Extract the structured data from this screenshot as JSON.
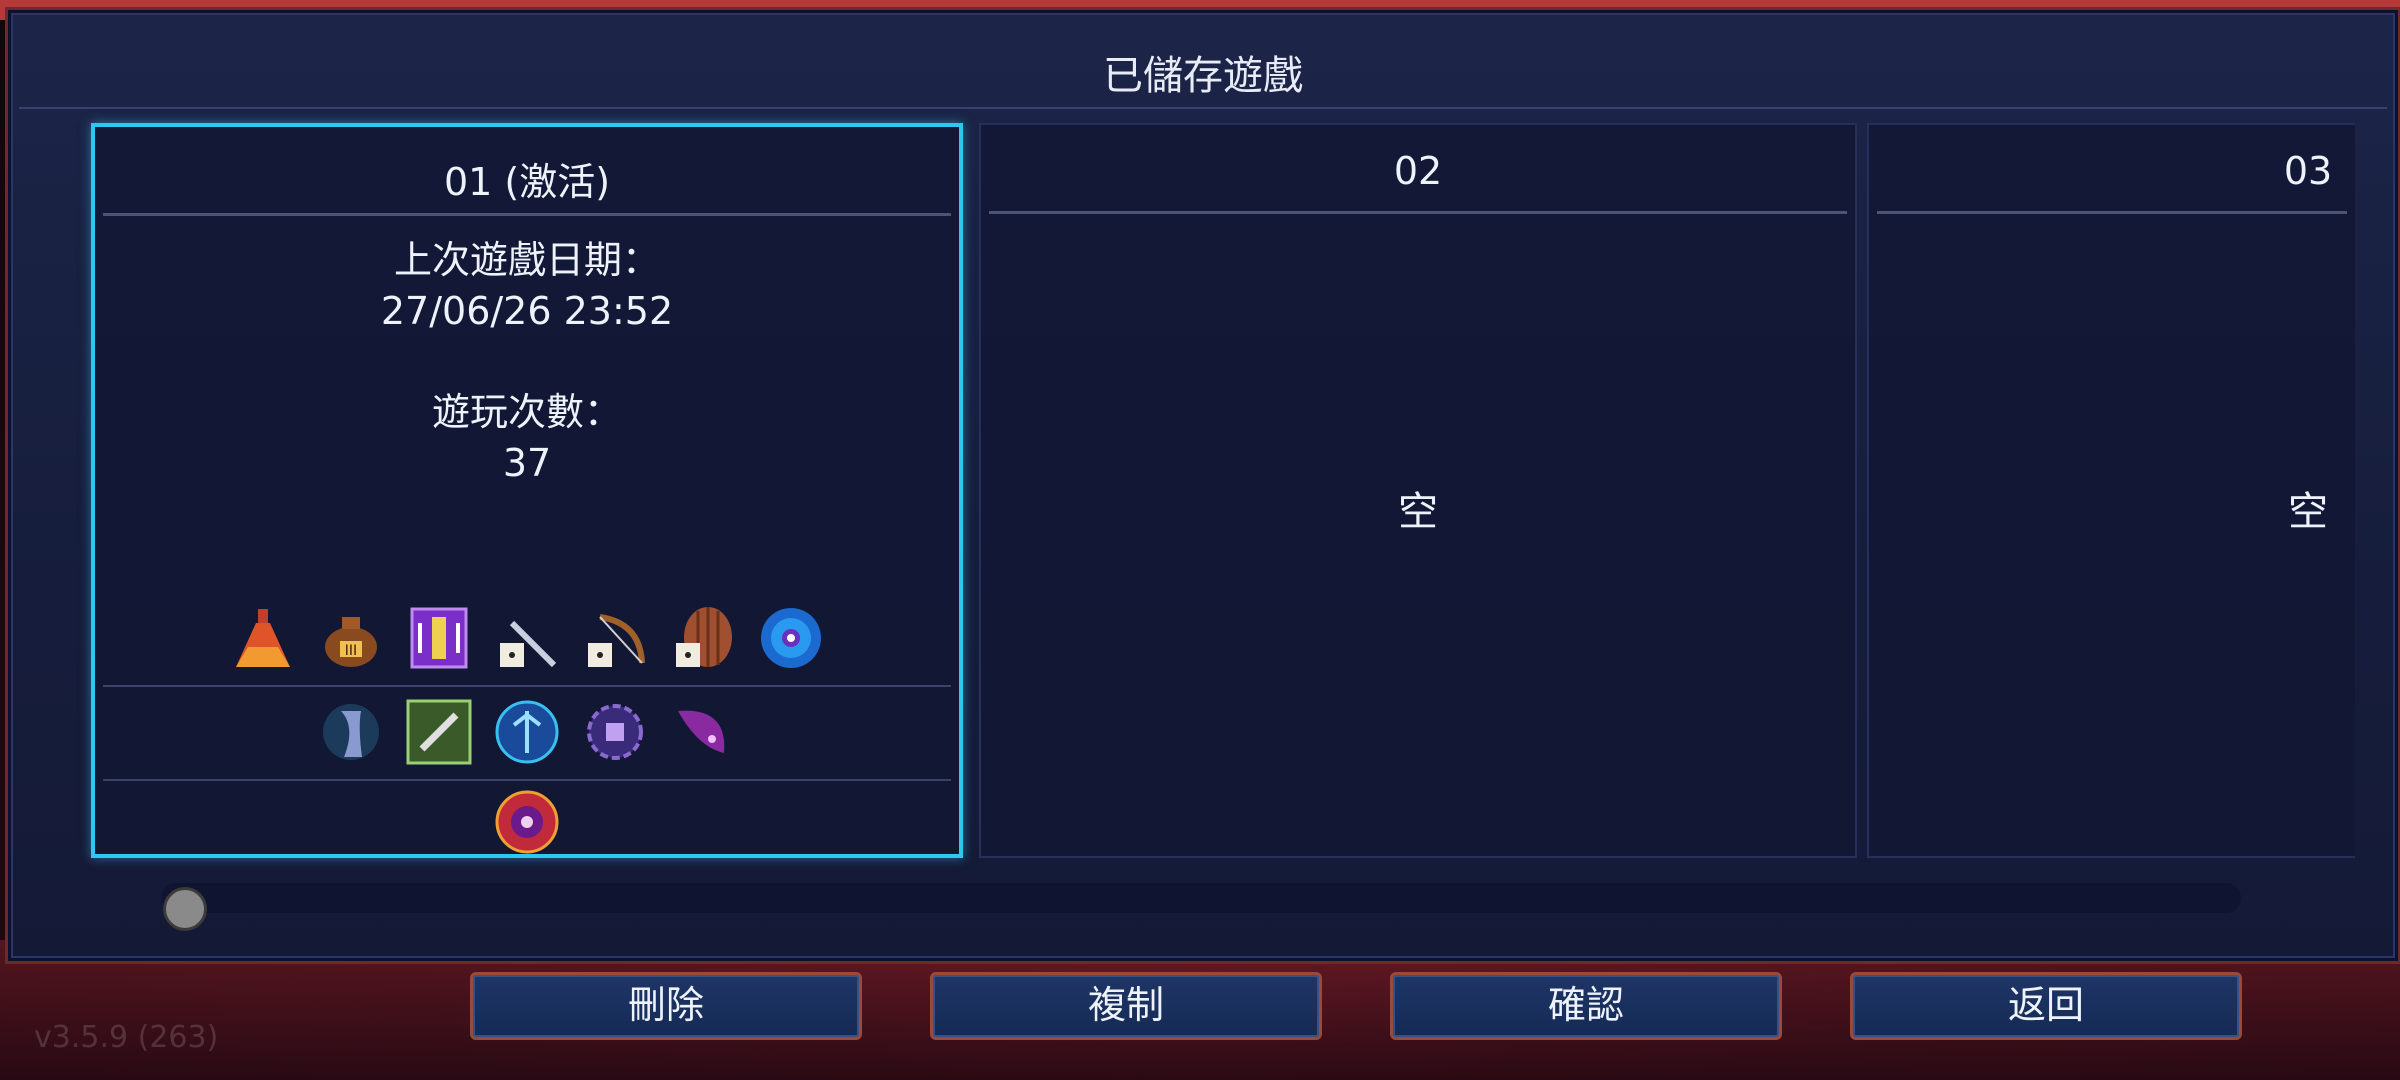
{
  "dialog": {
    "title": "已儲存遊戲"
  },
  "slots": [
    {
      "header": "01 (激活)",
      "last_played_label": "上次遊戲日期：",
      "last_played_value": "27/06/26 23:52",
      "play_count_label": "遊玩次數：",
      "play_count_value": "37",
      "item_icons": [
        "potion-flask-icon",
        "gold-sack-icon",
        "swap-card-icon",
        "dice-sword-icon",
        "dice-bow-icon",
        "dice-shield-icon",
        "blue-orb-icon"
      ],
      "skill_icons": [
        "phantom-cloak-icon",
        "wrench-skill-icon",
        "blue-rune-icon",
        "purple-gear-icon",
        "magenta-feather-icon"
      ],
      "relic_icons": [
        "red-eye-relic-icon"
      ]
    },
    {
      "header": "02",
      "empty_label": "空"
    },
    {
      "header": "03",
      "empty_label": "空"
    }
  ],
  "buttons": {
    "delete": "刪除",
    "copy": "複制",
    "confirm": "確認",
    "back": "返回"
  },
  "version": "v3.5.9 (263)"
}
